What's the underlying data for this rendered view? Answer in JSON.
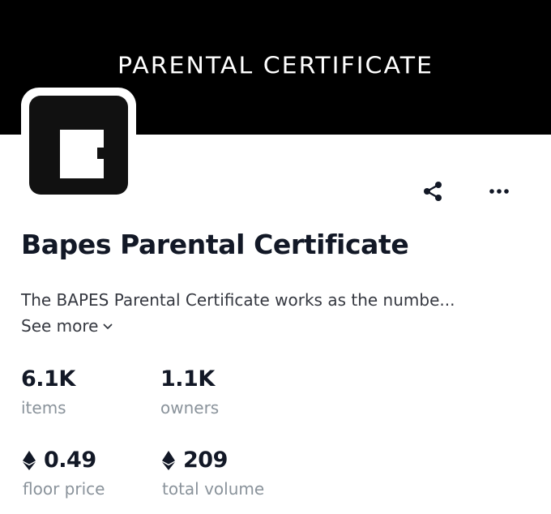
{
  "banner": {
    "title": "PARENTAL CERTIFICATE"
  },
  "collection": {
    "name": "Bapes Parental Certificate",
    "description": "The BAPES Parental Certificate works as the numbe...",
    "see_more_label": "See more"
  },
  "actions": {
    "share_icon": "share-icon",
    "more_icon": "more-options-icon"
  },
  "stats": {
    "items": {
      "value": "6.1K",
      "label": "items"
    },
    "owners": {
      "value": "1.1K",
      "label": "owners"
    },
    "floor_price": {
      "value": "0.49",
      "label": "floor price",
      "icon": "ethereum-icon"
    },
    "total_volume": {
      "value": "209",
      "label": "total volume",
      "icon": "ethereum-icon"
    }
  },
  "colors": {
    "banner_bg": "#000000",
    "banner_text": "#ffffff",
    "text_primary": "#121826",
    "text_secondary": "#353840",
    "text_muted": "#8a939b"
  }
}
